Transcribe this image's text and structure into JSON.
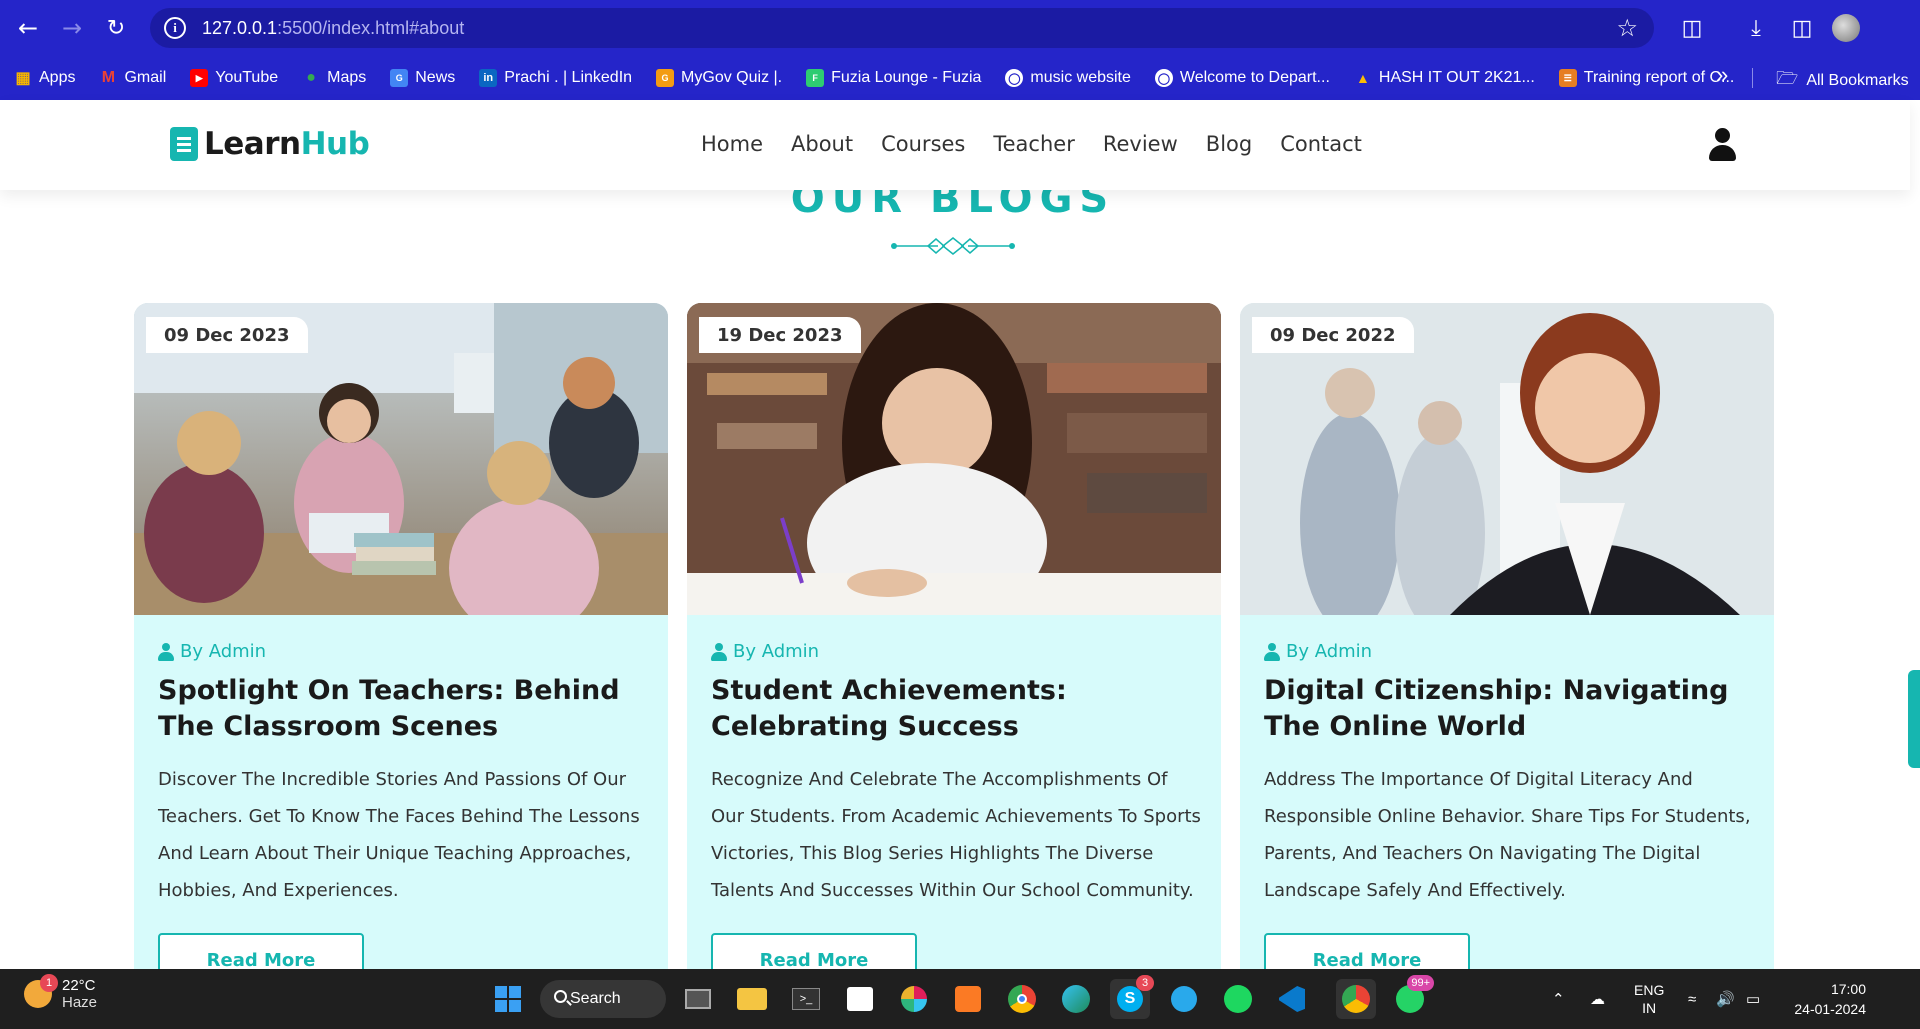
{
  "browser": {
    "url_host": "127.0.0.1",
    "url_rest": ":5500/index.html#about",
    "bookmarks": [
      "Apps",
      "Gmail",
      "YouTube",
      "Maps",
      "News",
      "Prachi . | LinkedIn",
      "MyGov Quiz |.",
      "Fuzia Lounge - Fuzia",
      "music website",
      "Welcome to Depart...",
      "HASH IT OUT 2K21...",
      "Training report of C..."
    ],
    "all_bookmarks": "All Bookmarks"
  },
  "site": {
    "logo_learn": "Learn",
    "logo_hub": "Hub",
    "nav": [
      "Home",
      "About",
      "Courses",
      "Teacher",
      "Review",
      "Blog",
      "Contact"
    ],
    "accent": "#16b6b0",
    "card_bg": "#d7fbfb"
  },
  "blogs": {
    "title": "OUR BLOGS",
    "cards": [
      {
        "date": "09 Dec 2023",
        "author": "By Admin",
        "heading": "Spotlight On Teachers: Behind The Classroom Scenes",
        "text": "Discover The Incredible Stories And Passions Of Our Teachers. Get To Know The Faces Behind The Lessons And Learn About Their Unique Teaching Approaches, Hobbies, And Experiences.",
        "button": "Read More"
      },
      {
        "date": "19 Dec 2023",
        "author": "By Admin",
        "heading": "Student Achievements: Celebrating Success",
        "text": "Recognize And Celebrate The Accomplishments Of Our Students. From Academic Achievements To Sports Victories, This Blog Series Highlights The Diverse Talents And Successes Within Our School Community.",
        "button": "Read More"
      },
      {
        "date": "09 Dec 2022",
        "author": "By Admin",
        "heading": "Digital Citizenship: Navigating The Online World",
        "text": "Address The Importance Of Digital Literacy And Responsible Online Behavior. Share Tips For Students, Parents, And Teachers On Navigating The Digital Landscape Safely And Effectively.",
        "button": "Read More"
      }
    ]
  },
  "taskbar": {
    "weather_temp": "22°C",
    "weather_desc": "Haze",
    "weather_badge": "1",
    "search": "Search",
    "skype_badge": "3",
    "whatsapp_badge": "99+",
    "lang1": "ENG",
    "lang2": "IN",
    "time": "17:00",
    "date": "24-01-2024"
  }
}
